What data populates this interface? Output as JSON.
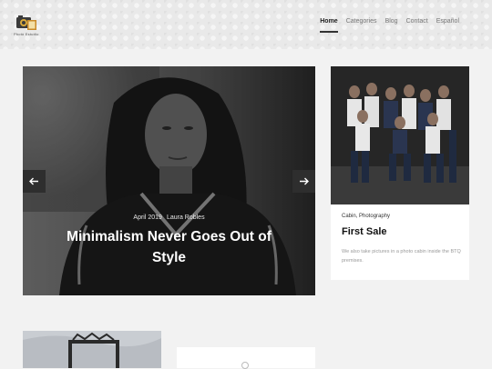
{
  "header": {
    "logo_text": "Photo Estudio",
    "nav": [
      {
        "label": "Home",
        "active": true
      },
      {
        "label": "Categories",
        "active": false
      },
      {
        "label": "Blog",
        "active": false
      },
      {
        "label": "Contact",
        "active": false
      },
      {
        "label": "Español",
        "active": false
      }
    ]
  },
  "hero": {
    "date": "April 2019",
    "author": "Laura Robles",
    "title": "Minimalism Never Goes Out of Style",
    "prev_icon": "arrow-left-icon",
    "next_icon": "arrow-right-icon"
  },
  "featured_card": {
    "categories": "Cabin, Photography",
    "title": "First Sale",
    "excerpt": "We also take pictures in a photo cabin inside the BTQ premises."
  }
}
